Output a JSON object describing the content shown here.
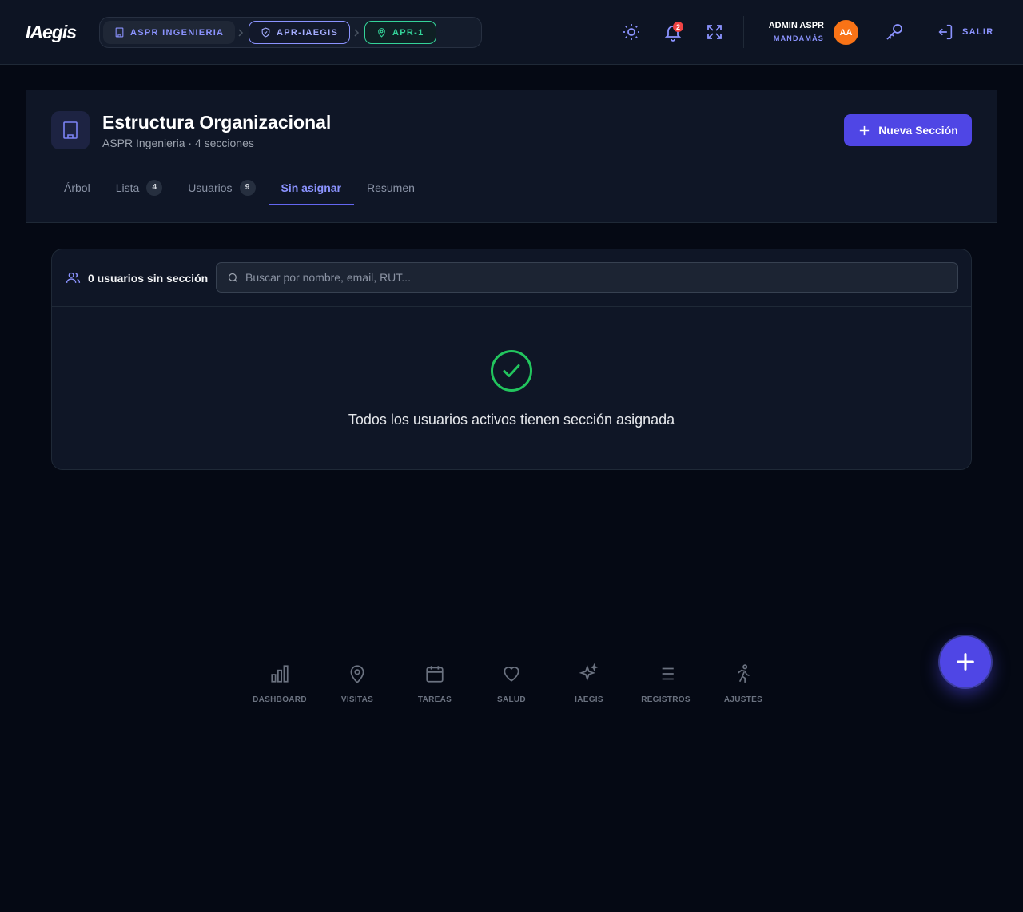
{
  "app": {
    "logo": "IAegis"
  },
  "breadcrumb": [
    {
      "label": "ASPR INGENIERIA",
      "icon": "building-icon"
    },
    {
      "label": "APR-IAEGIS",
      "icon": "shield-icon"
    },
    {
      "label": "APR-1",
      "icon": "map-pin-icon"
    }
  ],
  "topbar": {
    "notification_count": "2",
    "user": {
      "name": "ADMIN ASPR",
      "role": "MANDAMÁS",
      "initials": "AA"
    },
    "logout_label": "SALIR"
  },
  "page": {
    "title": "Estructura Organizacional",
    "subtitle": "ASPR Ingenieria · 4 secciones",
    "new_button_label": "Nueva Sección"
  },
  "tabs": [
    {
      "label": "Árbol",
      "count": null,
      "active": false
    },
    {
      "label": "Lista",
      "count": "4",
      "active": false
    },
    {
      "label": "Usuarios",
      "count": "9",
      "active": false
    },
    {
      "label": "Sin asignar",
      "count": null,
      "active": true
    },
    {
      "label": "Resumen",
      "count": null,
      "active": false
    }
  ],
  "unassigned": {
    "count_label": "0 usuarios sin sección",
    "search_placeholder": "Buscar por nombre, email, RUT...",
    "empty_message": "Todos los usuarios activos tienen sección asignada"
  },
  "bottom_nav": [
    {
      "label": "DASHBOARD",
      "icon": "bar-chart-icon"
    },
    {
      "label": "VISITAS",
      "icon": "map-pin-icon"
    },
    {
      "label": "TAREAS",
      "icon": "calendar-icon"
    },
    {
      "label": "SALUD",
      "icon": "heart-icon"
    },
    {
      "label": "IAEGIS",
      "icon": "sparkles-icon"
    },
    {
      "label": "REGISTROS",
      "icon": "list-icon"
    },
    {
      "label": "AJUSTES",
      "icon": "running-person-icon"
    }
  ],
  "colors": {
    "accent": "#4f46e5",
    "accent_light": "#8b93ff",
    "success": "#22c55e",
    "badge": "#ef4444",
    "avatar": "#f97316",
    "background": "#050914"
  }
}
